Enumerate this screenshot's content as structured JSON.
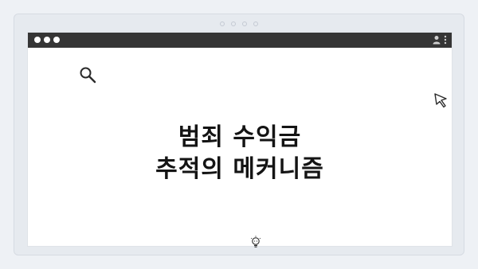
{
  "headline": {
    "line1": "범죄 수익금",
    "line2": "추적의 메커니즘"
  },
  "icons": {
    "window_controls": "three-dots-icon",
    "user": "user-icon",
    "menu": "vertical-menu-icon",
    "search": "search-icon",
    "cursor": "cursor-icon",
    "bulb": "lightbulb-icon"
  },
  "colors": {
    "background": "#eef1f5",
    "titlebar": "#353535",
    "text": "#141414"
  }
}
